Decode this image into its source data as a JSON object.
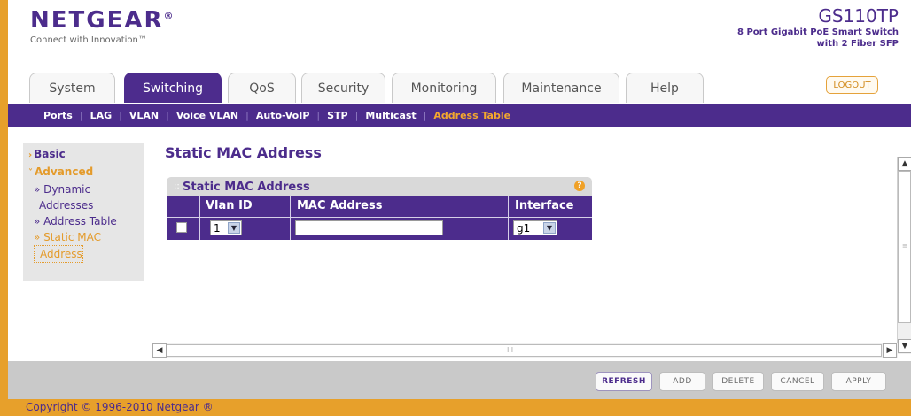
{
  "brand": {
    "logo": "NETGEAR",
    "registered_mark": "®",
    "tagline": "Connect with Innovation™"
  },
  "product": {
    "model": "GS110TP",
    "desc_line1": "8 Port Gigabit PoE Smart Switch",
    "desc_line2": "with 2 Fiber SFP"
  },
  "tabs": [
    {
      "label": "System"
    },
    {
      "label": "Switching",
      "active": true
    },
    {
      "label": "QoS"
    },
    {
      "label": "Security"
    },
    {
      "label": "Monitoring"
    },
    {
      "label": "Maintenance"
    },
    {
      "label": "Help"
    }
  ],
  "logout_label": "LOGOUT",
  "subnav": [
    {
      "label": "Ports"
    },
    {
      "label": "LAG"
    },
    {
      "label": "VLAN"
    },
    {
      "label": "Voice VLAN"
    },
    {
      "label": "Auto-VoIP"
    },
    {
      "label": "STP"
    },
    {
      "label": "Multicast"
    },
    {
      "label": "Address Table",
      "active": true
    }
  ],
  "leftnav": {
    "basic": "Basic",
    "advanced": "Advanced",
    "items": [
      {
        "line1": "» Dynamic",
        "line2": "Addresses"
      },
      {
        "line1": "» Address Table"
      },
      {
        "line1": "» Static MAC",
        "line2": "Address",
        "current": true
      }
    ]
  },
  "page": {
    "title": "Static MAC Address",
    "panel_title": "Static MAC Address",
    "help_glyph": "?"
  },
  "table": {
    "columns": [
      "Vlan ID",
      "MAC Address",
      "Interface"
    ],
    "row": {
      "checked": false,
      "vlan_id": "1",
      "mac_address": "",
      "interface": "g1"
    }
  },
  "buttons": {
    "refresh": "REFRESH",
    "add": "ADD",
    "delete": "DELETE",
    "cancel": "CANCEL",
    "apply": "APPLY"
  },
  "scrollbar": {
    "h_thumb_grip": "III"
  },
  "copyright": "Copyright © 1996-2010 Netgear ®",
  "colors": {
    "brand_purple": "#4c2c8c",
    "accent_orange": "#e7a02b"
  }
}
